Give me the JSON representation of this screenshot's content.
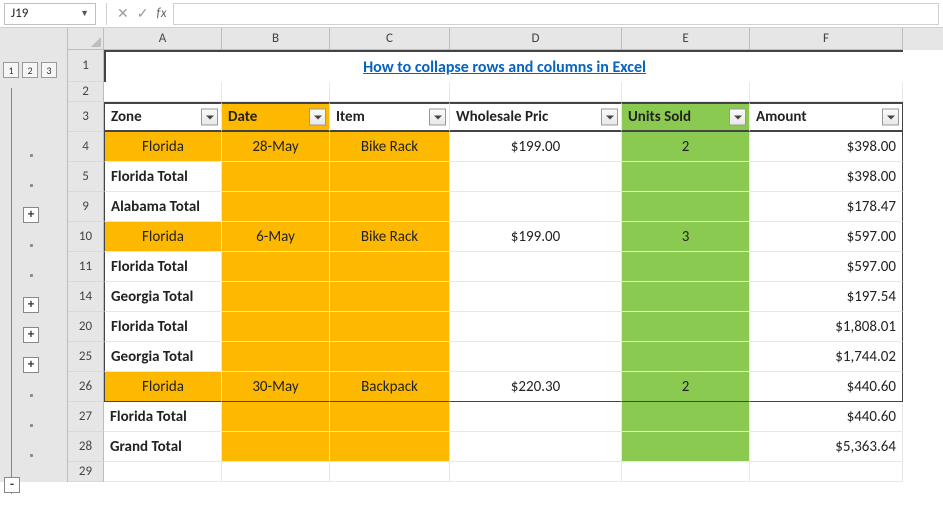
{
  "formula_bar": {
    "cell_ref": "J19",
    "formula": "",
    "fx_label": "fx"
  },
  "outline_levels": [
    "1",
    "2",
    "3"
  ],
  "columns": [
    "A",
    "B",
    "C",
    "D",
    "E",
    "F"
  ],
  "title": "How to collapse rows and columns in Excel",
  "header": {
    "zone": "Zone",
    "date": "Date",
    "item": "Item",
    "price": "Wholesale Pric",
    "units": "Units Sold",
    "amount": "Amount"
  },
  "rows": [
    {
      "num": "1",
      "type": "title"
    },
    {
      "num": "2",
      "type": "blank"
    },
    {
      "num": "3",
      "type": "header"
    },
    {
      "num": "4",
      "type": "data",
      "zone": "Florida",
      "date": "28-May",
      "item": "Bike Rack",
      "price": "$199.00",
      "units": "2",
      "amount": "$398.00"
    },
    {
      "num": "5",
      "type": "total",
      "label": "Florida Total",
      "amount": "$398.00"
    },
    {
      "num": "9",
      "type": "total",
      "label": "Alabama Total",
      "amount": "$178.47",
      "collapse": "+"
    },
    {
      "num": "10",
      "type": "data",
      "zone": "Florida",
      "date": "6-May",
      "item": "Bike Rack",
      "price": "$199.00",
      "units": "3",
      "amount": "$597.00"
    },
    {
      "num": "11",
      "type": "total",
      "label": "Florida Total",
      "amount": "$597.00"
    },
    {
      "num": "14",
      "type": "total",
      "label": "Georgia Total",
      "amount": "$197.54",
      "collapse": "+"
    },
    {
      "num": "20",
      "type": "total",
      "label": "Florida Total",
      "amount": "$1,808.01",
      "collapse": "+"
    },
    {
      "num": "25",
      "type": "total",
      "label": "Georgia Total",
      "amount": "$1,744.02",
      "collapse": "+"
    },
    {
      "num": "26",
      "type": "data",
      "zone": "Florida",
      "date": "30-May",
      "item": "Backpack",
      "price": "$220.30",
      "units": "2",
      "amount": "$440.60",
      "last": true
    },
    {
      "num": "27",
      "type": "total",
      "label": "Florida Total",
      "amount": "$440.60"
    },
    {
      "num": "28",
      "type": "grand",
      "label": "Grand Total",
      "amount": "$5,363.64",
      "collapse": "-"
    },
    {
      "num": "29",
      "type": "empty"
    }
  ]
}
